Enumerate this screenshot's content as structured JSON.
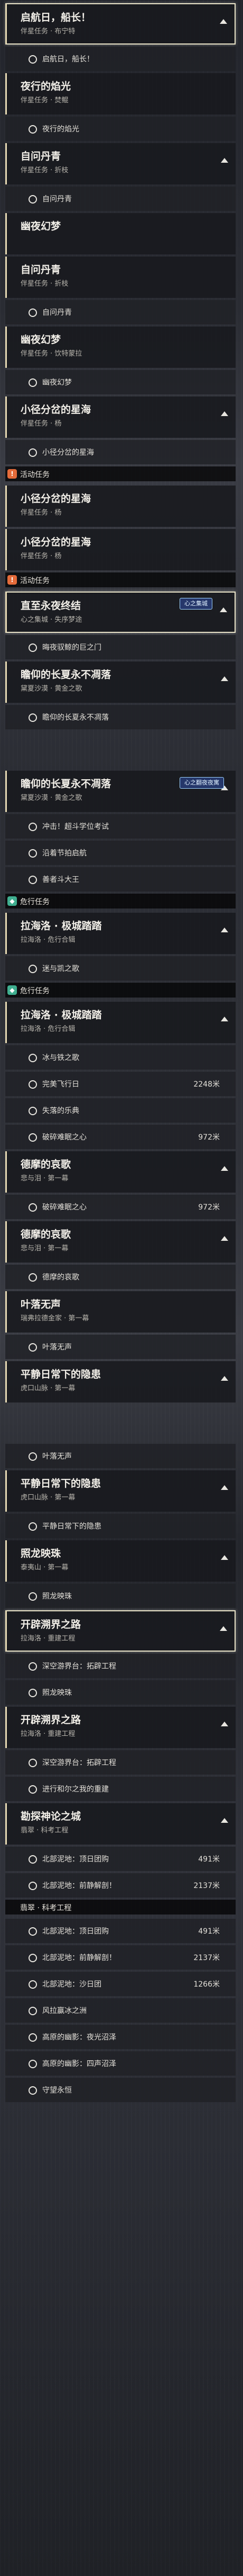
{
  "items": [
    {
      "kind": "card",
      "name": "启航日，船长！",
      "sub": "伴星任务 · 布宁特",
      "hl": true,
      "tri": "up"
    },
    {
      "kind": "step",
      "text": "启航日，船长！"
    },
    {
      "kind": "card",
      "name": "夜行的焰光",
      "sub": "伴星任务 · 焚鲲"
    },
    {
      "kind": "step",
      "text": "夜行的焰光"
    },
    {
      "kind": "card",
      "name": "自问丹青",
      "sub": "伴星任务 · 折枝",
      "tri": "up"
    },
    {
      "kind": "step",
      "text": "自问丹青"
    },
    {
      "kind": "card",
      "name": "幽夜幻梦",
      "sub": ""
    },
    {
      "kind": "card",
      "name": "自问丹青",
      "sub": "伴星任务 · 折枝"
    },
    {
      "kind": "step",
      "text": "自问丹青"
    },
    {
      "kind": "card",
      "name": "幽夜幻梦",
      "sub": "伴星任务 · 饮特蒙拉"
    },
    {
      "kind": "step",
      "text": "幽夜幻梦"
    },
    {
      "kind": "card",
      "name": "小径分岔的星海",
      "sub": "伴星任务 · 杨",
      "tri": "up"
    },
    {
      "kind": "step",
      "text": "小径分岔的星海"
    },
    {
      "kind": "header",
      "text": "活动任务",
      "color": "#e46b3a",
      "icon": "!"
    },
    {
      "kind": "card",
      "name": "小径分岔的星海",
      "sub": "伴星任务 · 杨"
    },
    {
      "kind": "card",
      "name": "小径分岔的星海",
      "sub": "伴星任务 · 杨"
    },
    {
      "kind": "header",
      "text": "活动任务",
      "color": "#e46b3a",
      "icon": "!"
    },
    {
      "kind": "card",
      "name": "直至永夜终结",
      "sub": "心之集城 · 失序梦途",
      "hl": true,
      "tri": "up"
    },
    {
      "kind": "step",
      "text": "晦夜驭鲸的巨之门"
    },
    {
      "kind": "card",
      "name": "瞻仰的长夏永不凋落",
      "sub": "黛夏沙漠 · 黄金之歌",
      "tri": "up"
    },
    {
      "kind": "step",
      "text": "瞻仰的长夏永不凋落"
    },
    {
      "kind": "gap"
    },
    {
      "kind": "card",
      "name": "瞻仰的长夏永不凋落",
      "sub": "黛夏沙漠 · 黄金之歌",
      "tri": "up"
    },
    {
      "kind": "step",
      "text": "冲击！超斗学位考试"
    },
    {
      "kind": "step",
      "text": "沿着节拍启航"
    },
    {
      "kind": "step",
      "text": "善者斗大王"
    },
    {
      "kind": "header",
      "text": "危行任务",
      "color": "#3fae8f",
      "icon": "◆"
    },
    {
      "kind": "card",
      "name": "拉海洛 · 极城踏踏",
      "sub": "拉海洛 · 危行合辑",
      "tri": "up"
    },
    {
      "kind": "step",
      "text": "迷与凯之歌"
    },
    {
      "kind": "header",
      "text": "危行任务",
      "color": "#3fae8f",
      "icon": "◆"
    },
    {
      "kind": "card",
      "name": "拉海洛 · 极城踏踏",
      "sub": "拉海洛 · 危行合辑",
      "tri": "up"
    },
    {
      "kind": "step",
      "text": "冰与铁之歌"
    },
    {
      "kind": "step",
      "text": "完美飞行日",
      "dist": "2248米"
    },
    {
      "kind": "step",
      "text": "失落的乐典"
    },
    {
      "kind": "step",
      "text": "破碎难眠之心",
      "dist": "972米"
    },
    {
      "kind": "card",
      "name": "德摩的哀歌",
      "sub": "悲与泪 · 第一幕",
      "tri": "up"
    },
    {
      "kind": "step",
      "text": "破碎难眠之心",
      "dist": "972米"
    },
    {
      "kind": "card",
      "name": "德摩的哀歌",
      "sub": "悲与泪 · 第一幕",
      "tri": "up"
    },
    {
      "kind": "step",
      "text": "德摩的哀歌"
    },
    {
      "kind": "card",
      "name": "叶落无声",
      "sub": "瑞弗拉德金家 · 第一幕"
    },
    {
      "kind": "step",
      "text": "叶落无声"
    },
    {
      "kind": "card",
      "name": "平静日常下的隐患",
      "sub": "虎口山脉 · 第一幕",
      "tri": "up"
    },
    {
      "kind": "gap"
    },
    {
      "kind": "step",
      "text": "叶落无声"
    },
    {
      "kind": "card",
      "name": "平静日常下的隐患",
      "sub": "虎口山脉 · 第一幕",
      "tri": "up"
    },
    {
      "kind": "step",
      "text": "平静日常下的隐患"
    },
    {
      "kind": "card",
      "name": "照龙映珠",
      "sub": "泰夷山 · 第一幕",
      "tri": "up"
    },
    {
      "kind": "step",
      "text": "照龙映珠"
    },
    {
      "kind": "card",
      "name": "开辟溯界之路",
      "sub": "拉海洛 · 重建工程",
      "hl": true,
      "tri": "up"
    },
    {
      "kind": "step",
      "text": "深空游界台：拓辟工程"
    },
    {
      "kind": "step",
      "text": "照龙映珠"
    },
    {
      "kind": "card",
      "name": "开辟溯界之路",
      "sub": "拉海洛 · 重建工程",
      "tri": "up"
    },
    {
      "kind": "step",
      "text": "深空游界台：拓辟工程"
    },
    {
      "kind": "step",
      "text": "进行和尔之我的重建"
    },
    {
      "kind": "card",
      "name": "勘探神论之城",
      "sub": "翡翠 · 科考工程",
      "tri": "up"
    },
    {
      "kind": "step",
      "text": "北部泥地：顶日团购",
      "dist": "491米"
    },
    {
      "kind": "step",
      "text": "北部泥地：前静解剖！",
      "dist": "2137米"
    },
    {
      "kind": "header",
      "text": "翡翠 · 科考工程",
      "color": "transparent",
      "icon": ""
    },
    {
      "kind": "step",
      "text": "北部泥地：顶日团购",
      "dist": "491米"
    },
    {
      "kind": "step",
      "text": "北部泥地：前静解剖！",
      "dist": "2137米"
    },
    {
      "kind": "step",
      "text": "北部泥地：沙日团",
      "dist": "1266米"
    },
    {
      "kind": "step",
      "text": "风拉赢冰之洲"
    },
    {
      "kind": "step",
      "text": "高原的幽影：夜光沼泽"
    },
    {
      "kind": "step",
      "text": "高原的幽影：四声沼泽"
    },
    {
      "kind": "step",
      "text": "守望永恒"
    }
  ],
  "badges": [
    {
      "text": "心之集城",
      "at": 17
    },
    {
      "text": "心之翻夜夜寓",
      "at": 22
    }
  ],
  "cursor_text": ""
}
